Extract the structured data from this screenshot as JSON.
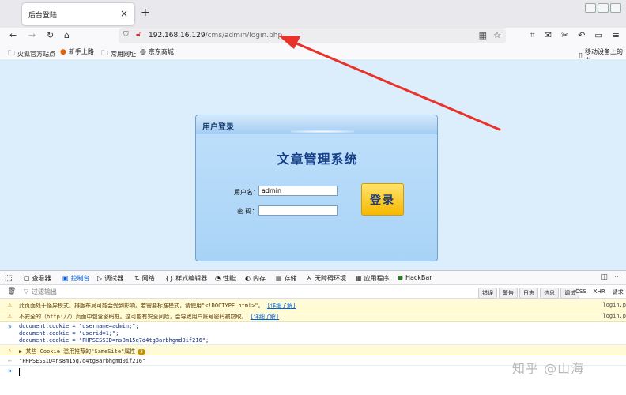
{
  "browser": {
    "tab_title": "后台登陆",
    "tab_close": "×",
    "new_tab": "+",
    "url_host": "192.168.16.129",
    "url_path": "/cms/admin/login.php",
    "nav": {
      "back": "←",
      "forward": "→",
      "reload": "↻",
      "home": "⌂"
    },
    "bookmarks": [
      {
        "label": "火狐官方站点",
        "icon": "folder-icon"
      },
      {
        "label": "新手上路",
        "icon": "firefox-icon"
      },
      {
        "label": "常用网址",
        "icon": "folder-icon"
      },
      {
        "label": "京东商城",
        "icon": "globe-icon"
      }
    ],
    "mobile_bookmarks": "移动设备上的书"
  },
  "login": {
    "header_title": "用户登录",
    "system_title": "文章管理系统",
    "username_label": "用户名：",
    "username_value": "admin",
    "password_label": "密  码：",
    "password_value": "",
    "submit_label": "登录"
  },
  "devtools": {
    "tabs": [
      {
        "label": "查看器",
        "icon": "inspector-icon"
      },
      {
        "label": "控制台",
        "icon": "console-icon",
        "active": true
      },
      {
        "label": "调试器",
        "icon": "debugger-icon"
      },
      {
        "label": "网络",
        "icon": "network-icon"
      },
      {
        "label": "样式编辑器",
        "icon": "style-editor-icon"
      },
      {
        "label": "性能",
        "icon": "performance-icon"
      },
      {
        "label": "内存",
        "icon": "memory-icon"
      },
      {
        "label": "存储",
        "icon": "storage-icon"
      },
      {
        "label": "无障碍环境",
        "icon": "accessibility-icon"
      },
      {
        "label": "应用程序",
        "icon": "application-icon"
      },
      {
        "label": "HackBar",
        "icon": "hackbar-icon"
      }
    ],
    "filter_placeholder": "过滤输出",
    "levels": [
      "错误",
      "警告",
      "日志",
      "信息",
      "调试"
    ],
    "extra": [
      "CSS",
      "XHR",
      "请求"
    ],
    "logs": {
      "warn1": "此页面处于怪异模式。排版布局可能会受到影响。若需要标准模式，请使用\"<!DOCTYPE html>\"。",
      "warn1_link": "[详细了解]",
      "warn1_src": "login.p",
      "warn2": "不安全的（http://）页面中包含密码框。这可能有安全风险，会导致用户账号密码被窃取。",
      "warn2_link": "[详细了解]",
      "warn2_src": "login.p",
      "cmd1": "document.cookie = \"username=admin;\";",
      "cmd2": "document.cookie = \"userid=1;\";",
      "cmd3": "document.cookie = \"PHPSESSID=ns8m15q7d4tg8arbhgmd0if216\";",
      "warn3": "▶ 某些 Cookie 滥用推荐的\"SameSite\"属性",
      "warn3_count": "3",
      "result": "\"PHPSESSID=ns8m15q7d4tg8arbhgmd0if216\""
    }
  },
  "watermark": "知乎 @山海",
  "colors": {
    "arrow": "#e8322a",
    "accent": "#0060df"
  }
}
